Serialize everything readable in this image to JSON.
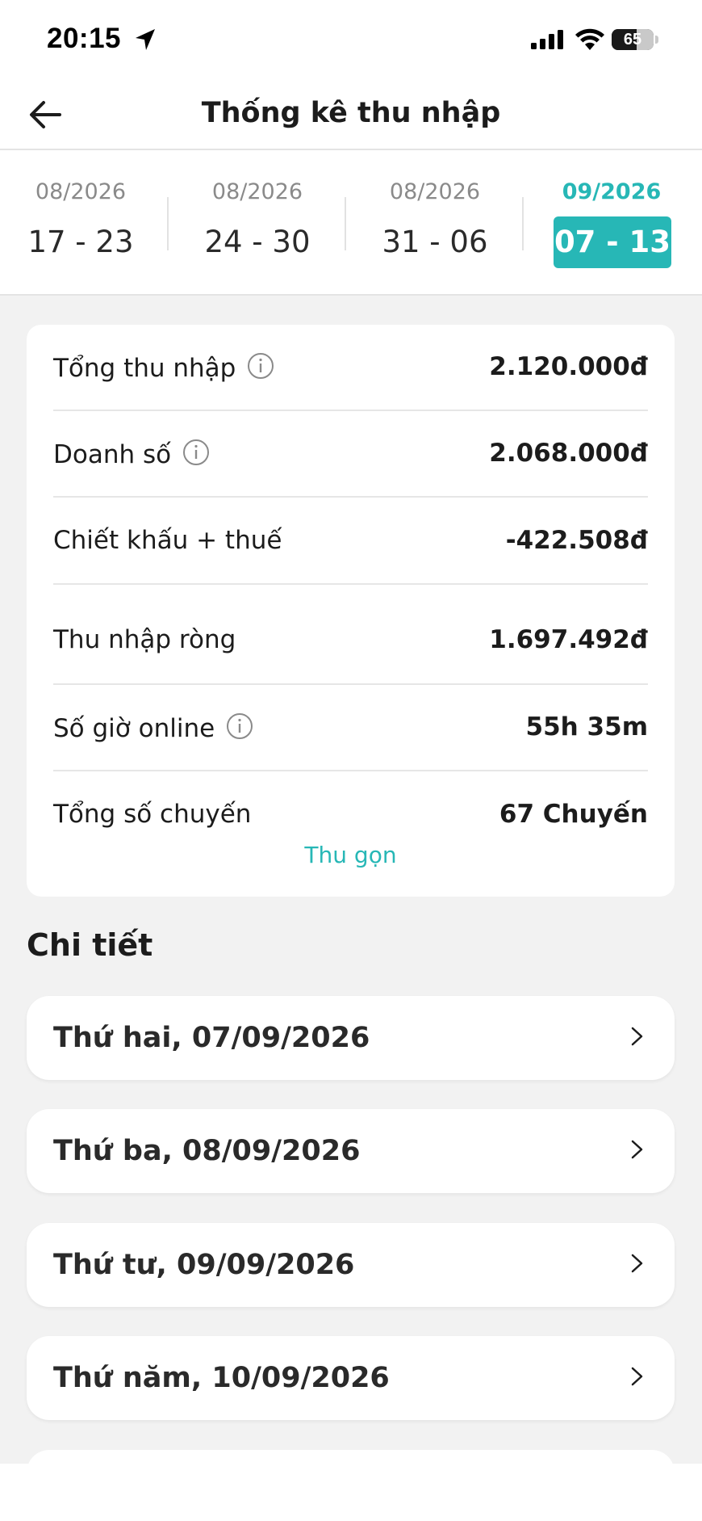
{
  "status_bar": {
    "time": "20:15",
    "battery": "65",
    "icons": [
      "location-arrow-icon",
      "signal-bars-icon",
      "wifi-icon",
      "battery-icon"
    ]
  },
  "header": {
    "title": "Thống kê thu nhập",
    "back_icon": "arrow-left-icon"
  },
  "weeks": [
    {
      "month": "08/2026",
      "range": "17 - 23",
      "active": false
    },
    {
      "month": "08/2026",
      "range": "24 - 30",
      "active": false
    },
    {
      "month": "08/2026",
      "range": "31 - 06",
      "active": false
    },
    {
      "month": "09/2026",
      "range": "07 - 13",
      "active": true
    }
  ],
  "summary": {
    "rows": [
      {
        "label": "Tổng thu nhập",
        "value": "2.120.000đ",
        "has_info": true
      },
      {
        "label": "Doanh số",
        "value": "2.068.000đ",
        "has_info": true
      },
      {
        "label": "Chiết khấu + thuế",
        "value": "-422.508đ",
        "has_info": false
      },
      {
        "label": "Thu nhập ròng",
        "value": "1.697.492đ",
        "has_info": false
      },
      {
        "label": "Số giờ online",
        "value": "55h 35m",
        "has_info": true
      },
      {
        "label": "Tổng số chuyến",
        "value": "67 Chuyến",
        "has_info": false
      }
    ],
    "collapse_label": "Thu gọn"
  },
  "details": {
    "title": "Chi tiết",
    "days": [
      {
        "label": "Thứ hai, 07/09/2026"
      },
      {
        "label": "Thứ ba, 08/09/2026"
      },
      {
        "label": "Thứ tư, 09/09/2026"
      },
      {
        "label": "Thứ năm, 10/09/2026"
      }
    ]
  },
  "colors": {
    "accent": "#27b7b6",
    "background": "#f2f2f2",
    "card": "#ffffff",
    "text": "#1c1c1c",
    "muted": "#8a8a8a"
  }
}
